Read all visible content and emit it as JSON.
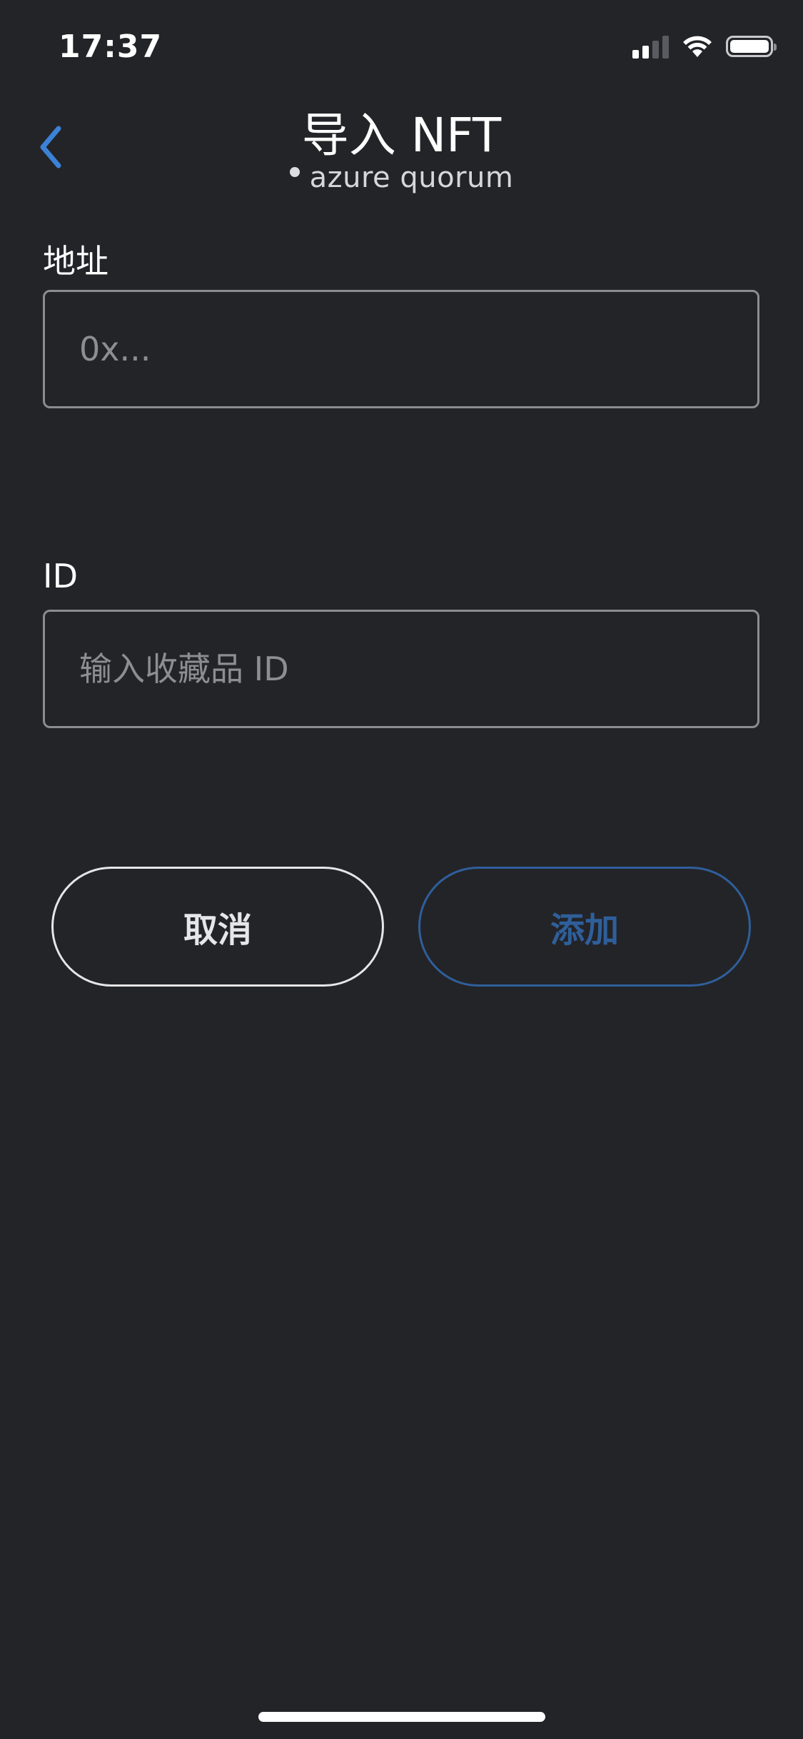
{
  "status_bar": {
    "time": "17:37",
    "signal_icon": "cellular-signal-icon",
    "wifi_icon": "wifi-icon",
    "battery_icon": "battery-icon"
  },
  "header": {
    "back_icon": "chevron-left-icon",
    "title": "导入 NFT",
    "network_name": "azure quorum"
  },
  "form": {
    "address": {
      "label": "地址",
      "value": "",
      "placeholder": "0x..."
    },
    "token_id": {
      "label": "ID",
      "value": "",
      "placeholder": "输入收藏品 ID"
    }
  },
  "actions": {
    "cancel_label": "取消",
    "add_label": "添加"
  },
  "colors": {
    "background": "#232428",
    "accent": "#3b82d6",
    "add_disabled": "#2f5f9b"
  }
}
